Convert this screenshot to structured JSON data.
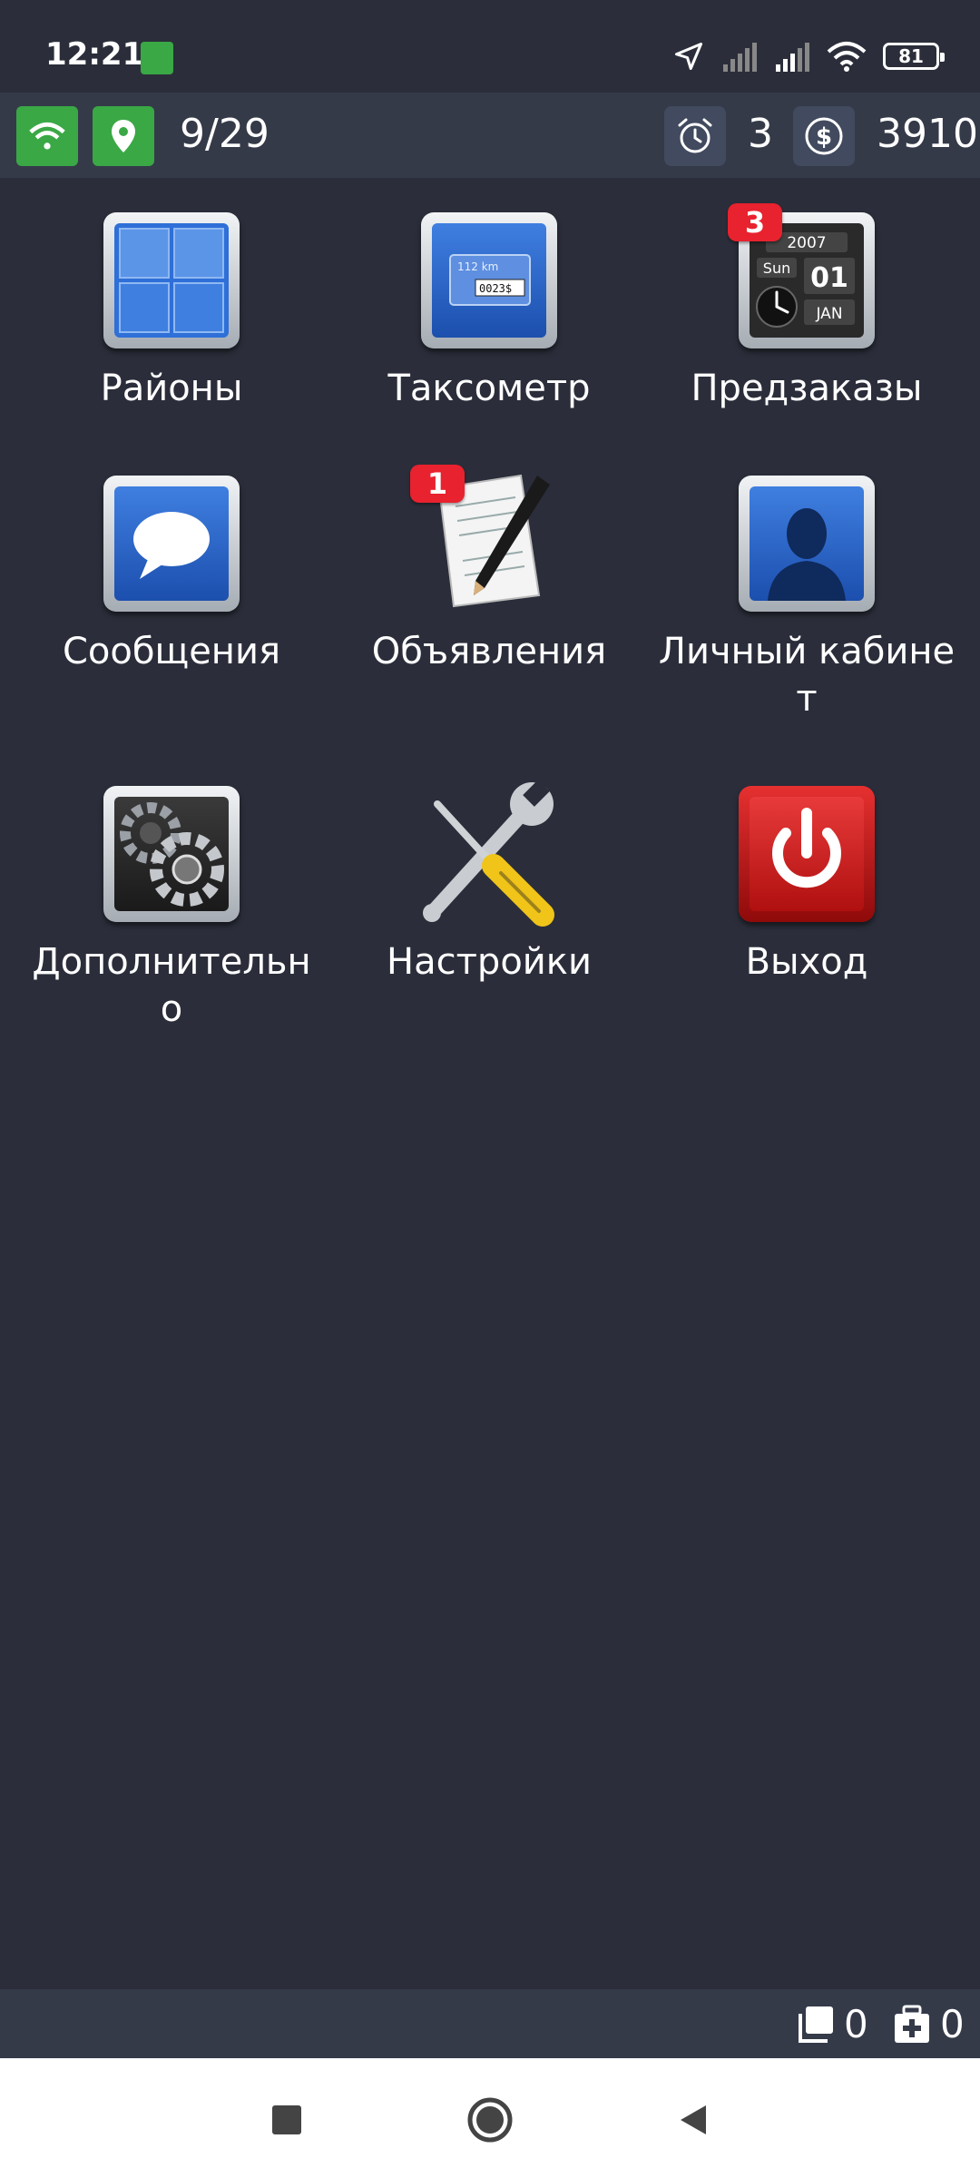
{
  "status_bar": {
    "time": "12:21",
    "battery_level": "81",
    "icons": [
      "app-notification-icon",
      "location-arrow-icon",
      "signal-icon",
      "signal-icon",
      "wifi-icon",
      "battery-icon"
    ]
  },
  "info_bar": {
    "wifi_icon": "wifi-icon",
    "location_icon": "location-pin-icon",
    "counter": "9/29",
    "alarm_count": "3",
    "balance": "3910",
    "accent": "#3aa845"
  },
  "tiles": [
    {
      "label": "Районы",
      "icon": "districts-grid-icon"
    },
    {
      "label": "Таксометр",
      "icon": "taximeter-icon"
    },
    {
      "label": "Предзаказы",
      "icon": "calendar-clock-icon",
      "badge": "3"
    },
    {
      "label": "Сообщения",
      "icon": "speech-bubble-icon"
    },
    {
      "label": "Объявления",
      "icon": "notepad-pen-icon",
      "badge": "1"
    },
    {
      "label": "Личный кабинет",
      "icon": "user-silhouette-icon"
    },
    {
      "label": "Дополнительно",
      "icon": "gears-icon"
    },
    {
      "label": "Настройки",
      "icon": "tools-icon"
    },
    {
      "label": "Выход",
      "icon": "power-icon"
    }
  ],
  "taximeter_icon_text": {
    "distance": "112 km",
    "amount": "0023$"
  },
  "calendar_icon_text": {
    "year": "2007",
    "weekday": "Sun",
    "day": "01",
    "month": "JAN"
  },
  "bottom_bar": {
    "orders_count": "0",
    "medical_count": "0"
  },
  "badge_color": "#e8222e"
}
